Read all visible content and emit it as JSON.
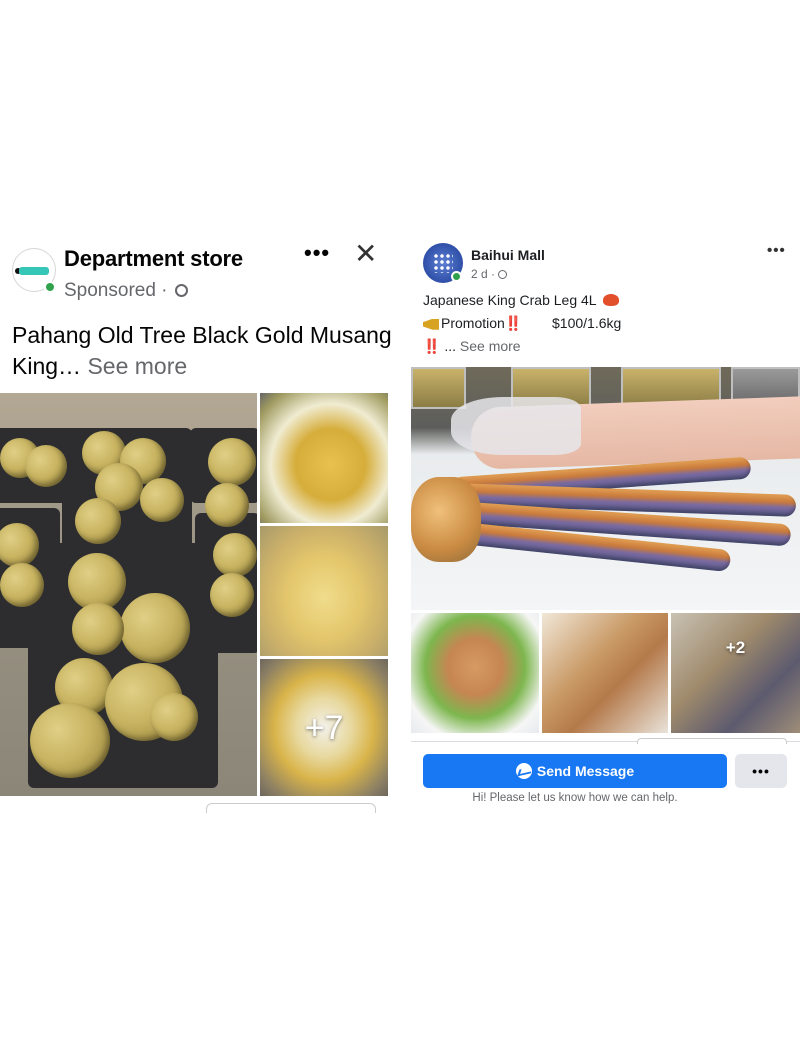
{
  "left_post": {
    "page_name": "Department store",
    "sponsored": "Sponsored ·",
    "more_label": "•••",
    "close_label": "✕",
    "text_main": "Pahang Old Tree Black Gold Musang King…",
    "see_more": "See more",
    "extra_photos": "+7",
    "icons": [
      "store-logo-icon",
      "globe-icon",
      "more-icon",
      "close-icon"
    ]
  },
  "right_post": {
    "page_name": "Baihui Mall",
    "time": "2 d ·",
    "more_label": "•••",
    "line1": "Japanese King Crab Leg 4L",
    "line2_label": "Promotion",
    "line2_marks": "‼️",
    "price": "$100/1.6kg",
    "line3_marks": "‼️",
    "line3_text": "...",
    "see_more": "See more",
    "extra_photos": "+2",
    "send_button": "Send Message",
    "dots_button": "•••",
    "hint": "Hi! Please let us know how we can help.",
    "icons": [
      "mall-logo-icon",
      "globe-icon",
      "crab-emoji-icon",
      "megaphone-emoji-icon",
      "messenger-icon"
    ]
  },
  "colors": {
    "brand_blue": "#1877f2",
    "online_green": "#31a24c",
    "alert_red": "#e41e3f",
    "secondary_text": "#65676b"
  }
}
